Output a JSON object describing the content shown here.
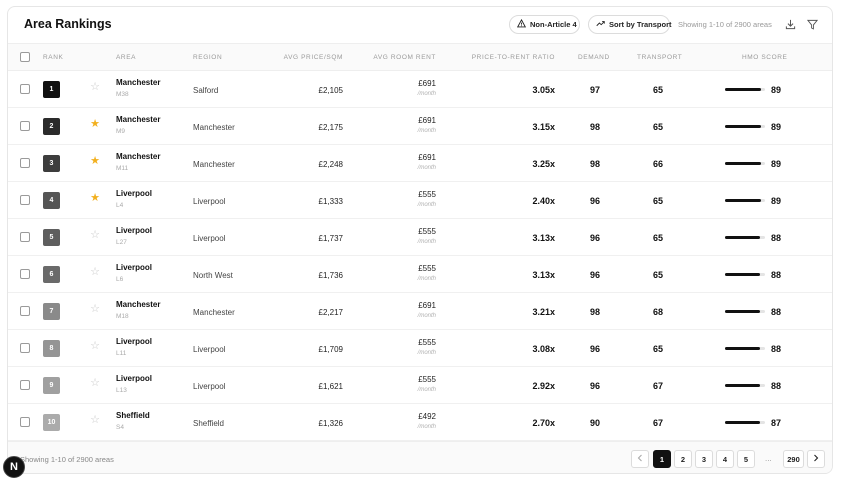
{
  "header": {
    "title": "Area Rankings",
    "article_button": "Non-Article 4",
    "sort_button": "Sort by Transport",
    "showing": "Showing 1-10 of 2900 areas"
  },
  "columns": {
    "rank": "Rank",
    "area": "Area",
    "region": "Region",
    "price": "Avg Price/SQM",
    "rent": "Avg Room Rent",
    "ratio": "Price-to-Rent Ratio",
    "demand": "Demand",
    "transport": "Transport",
    "score": "HMO Score"
  },
  "rows": [
    {
      "rank": "1",
      "starred": false,
      "area": "Manchester",
      "code": "M38",
      "region": "Salford",
      "price": "£2,105",
      "rent": "£691",
      "rent_unit": "/month",
      "ratio": "3.05x",
      "demand": "97",
      "transport": "65",
      "score": "89",
      "score_pct": 89,
      "badge_color": "#111111"
    },
    {
      "rank": "2",
      "starred": true,
      "area": "Manchester",
      "code": "M9",
      "region": "Manchester",
      "price": "£2,175",
      "rent": "£691",
      "rent_unit": "/month",
      "ratio": "3.15x",
      "demand": "98",
      "transport": "65",
      "score": "89",
      "score_pct": 89,
      "badge_color": "#2b2b2b"
    },
    {
      "rank": "3",
      "starred": true,
      "area": "Manchester",
      "code": "M11",
      "region": "Manchester",
      "price": "£2,248",
      "rent": "£691",
      "rent_unit": "/month",
      "ratio": "3.25x",
      "demand": "98",
      "transport": "66",
      "score": "89",
      "score_pct": 89,
      "badge_color": "#3d3d3d"
    },
    {
      "rank": "4",
      "starred": true,
      "area": "Liverpool",
      "code": "L4",
      "region": "Liverpool",
      "price": "£1,333",
      "rent": "£555",
      "rent_unit": "/month",
      "ratio": "2.40x",
      "demand": "96",
      "transport": "65",
      "score": "89",
      "score_pct": 89,
      "badge_color": "#555555"
    },
    {
      "rank": "5",
      "starred": false,
      "area": "Liverpool",
      "code": "L27",
      "region": "Liverpool",
      "price": "£1,737",
      "rent": "£555",
      "rent_unit": "/month",
      "ratio": "3.13x",
      "demand": "96",
      "transport": "65",
      "score": "88",
      "score_pct": 88,
      "badge_color": "#5e5e5e"
    },
    {
      "rank": "6",
      "starred": false,
      "area": "Liverpool",
      "code": "L6",
      "region": "North West",
      "price": "£1,736",
      "rent": "£555",
      "rent_unit": "/month",
      "ratio": "3.13x",
      "demand": "96",
      "transport": "65",
      "score": "88",
      "score_pct": 88,
      "badge_color": "#6a6a6a"
    },
    {
      "rank": "7",
      "starred": false,
      "area": "Manchester",
      "code": "M18",
      "region": "Manchester",
      "price": "£2,217",
      "rent": "£691",
      "rent_unit": "/month",
      "ratio": "3.21x",
      "demand": "98",
      "transport": "68",
      "score": "88",
      "score_pct": 88,
      "badge_color": "#8a8a8a"
    },
    {
      "rank": "8",
      "starred": false,
      "area": "Liverpool",
      "code": "L11",
      "region": "Liverpool",
      "price": "£1,709",
      "rent": "£555",
      "rent_unit": "/month",
      "ratio": "3.08x",
      "demand": "96",
      "transport": "65",
      "score": "88",
      "score_pct": 88,
      "badge_color": "#959595"
    },
    {
      "rank": "9",
      "starred": false,
      "area": "Liverpool",
      "code": "L13",
      "region": "Liverpool",
      "price": "£1,621",
      "rent": "£555",
      "rent_unit": "/month",
      "ratio": "2.92x",
      "demand": "96",
      "transport": "67",
      "score": "88",
      "score_pct": 88,
      "badge_color": "#a0a0a0"
    },
    {
      "rank": "10",
      "starred": false,
      "area": "Sheffield",
      "code": "S4",
      "region": "Sheffield",
      "price": "£1,326",
      "rent": "£492",
      "rent_unit": "/month",
      "ratio": "2.70x",
      "demand": "90",
      "transport": "67",
      "score": "87",
      "score_pct": 87,
      "badge_color": "#ababab"
    }
  ],
  "footer": {
    "showing": "Showing 1-10 of 2900 areas",
    "pages": [
      "1",
      "2",
      "3",
      "4",
      "5"
    ],
    "ellipsis": "...",
    "last_page": "290",
    "current_page": "1"
  },
  "logo": {
    "letter": "N"
  },
  "colors": {
    "star_filled": "#f2b01e",
    "star_empty": "#c8c8c8",
    "accent": "#111111"
  }
}
